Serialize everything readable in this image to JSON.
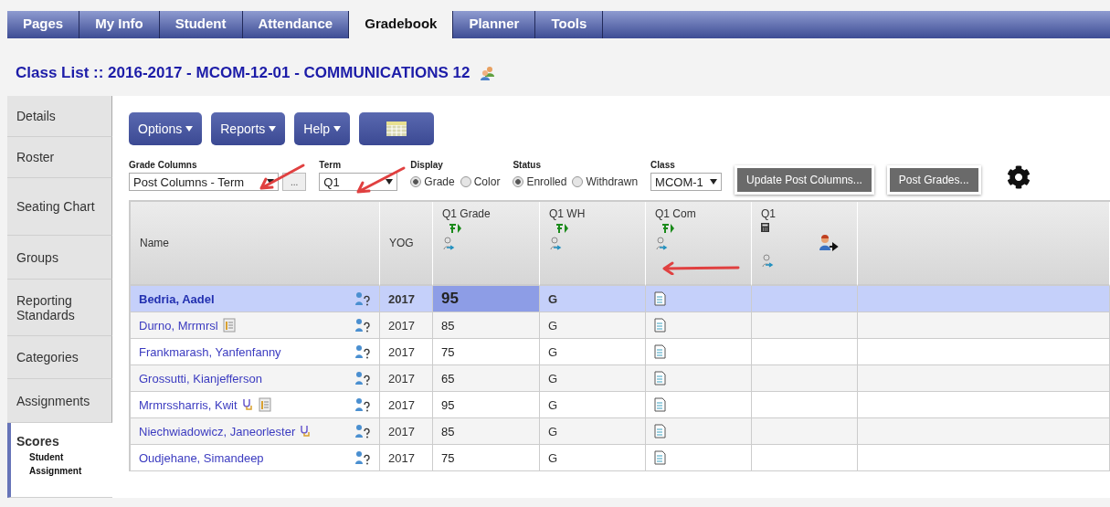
{
  "top_tabs": [
    {
      "label": "Pages",
      "selected": false
    },
    {
      "label": "My Info",
      "selected": false
    },
    {
      "label": "Student",
      "selected": false
    },
    {
      "label": "Attendance",
      "selected": false
    },
    {
      "label": "Gradebook",
      "selected": true
    },
    {
      "label": "Planner",
      "selected": false
    },
    {
      "label": "Tools",
      "selected": false
    }
  ],
  "page_title": "Class List :: 2016-2017 - MCOM-12-01 - COMMUNICATIONS 12",
  "side_tabs": [
    {
      "label": "Details",
      "selected": false
    },
    {
      "label": "Roster",
      "selected": false
    },
    {
      "label": "Seating Chart",
      "selected": false
    },
    {
      "label": "Groups",
      "selected": false
    },
    {
      "label": "Reporting Standards",
      "selected": false
    },
    {
      "label": "Categories",
      "selected": false
    },
    {
      "label": "Assignments",
      "selected": false
    },
    {
      "label": "Scores",
      "selected": true,
      "children": [
        {
          "label": "Student"
        },
        {
          "label": "Assignment"
        }
      ]
    }
  ],
  "menu_buttons": [
    "Options",
    "Reports",
    "Help"
  ],
  "filters": {
    "grade_columns": {
      "label": "Grade Columns",
      "value": "Post Columns - Term",
      "more": "..."
    },
    "term": {
      "label": "Term",
      "value": "Q1"
    },
    "display": {
      "label": "Display",
      "options": [
        {
          "label": "Grade",
          "selected": true
        },
        {
          "label": "Color",
          "selected": false
        }
      ]
    },
    "status": {
      "label": "Status",
      "options": [
        {
          "label": "Enrolled",
          "selected": true
        },
        {
          "label": "Withdrawn",
          "selected": false
        }
      ]
    },
    "class": {
      "label": "Class",
      "value": "MCOM-1"
    }
  },
  "action_buttons": [
    "Update Post Columns...",
    "Post Grades..."
  ],
  "table": {
    "columns": [
      {
        "label": "Name",
        "kind": "name"
      },
      {
        "label": "YOG",
        "kind": "yog"
      },
      {
        "label": "Q1 Grade",
        "kind": "post"
      },
      {
        "label": "Q1 WH",
        "kind": "post"
      },
      {
        "label": "Q1 Com",
        "kind": "post"
      },
      {
        "label": "Q1",
        "kind": "calc"
      }
    ],
    "rows": [
      {
        "name": "Bedria, Aadel",
        "notes": false,
        "health": false,
        "yog": "2017",
        "grade": "95",
        "wh": "G",
        "selected": true
      },
      {
        "name": "Durno, Mrrmrsl",
        "notes": true,
        "health": false,
        "yog": "2017",
        "grade": "85",
        "wh": "G",
        "selected": false
      },
      {
        "name": "Frankmarash, Yanfenfanny",
        "notes": false,
        "health": false,
        "yog": "2017",
        "grade": "75",
        "wh": "G",
        "selected": false
      },
      {
        "name": "Grossutti, Kianjefferson",
        "notes": false,
        "health": false,
        "yog": "2017",
        "grade": "65",
        "wh": "G",
        "selected": false
      },
      {
        "name": "Mrmrssharris, Kwit",
        "notes": true,
        "health": true,
        "yog": "2017",
        "grade": "95",
        "wh": "G",
        "selected": false
      },
      {
        "name": "Niechwiadowicz, Janeorlester",
        "notes": false,
        "health": true,
        "yog": "2017",
        "grade": "85",
        "wh": "G",
        "selected": false
      },
      {
        "name": "Oudjehane, Simandeep",
        "notes": false,
        "health": false,
        "yog": "2017",
        "grade": "75",
        "wh": "G",
        "selected": false
      }
    ]
  }
}
